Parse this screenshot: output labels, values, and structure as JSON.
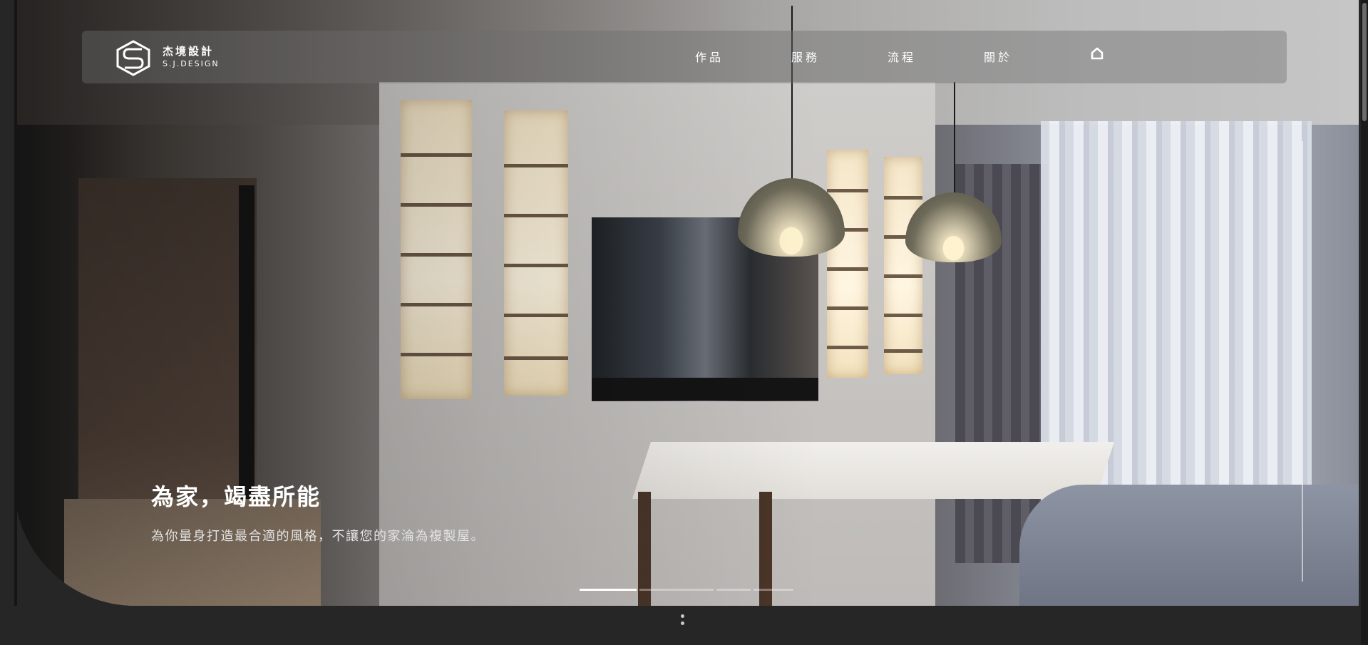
{
  "brand": {
    "name_zh": "杰境設計",
    "name_en": "S.J.DESIGN"
  },
  "nav": {
    "items": [
      {
        "label": "作品"
      },
      {
        "label": "服務"
      },
      {
        "label": "流程"
      },
      {
        "label": "關於"
      }
    ],
    "home_icon": "home-icon"
  },
  "hero": {
    "title": "為家，竭盡所能",
    "subtitle": "為你量身打造最合適的風格，不讓您的家淪為複製屋。",
    "slides_total": 4,
    "active_slide": 1
  },
  "colors": {
    "background": "#262626",
    "text": "#ffffff",
    "nav_bg": "rgba(110,110,110,0.42)"
  }
}
